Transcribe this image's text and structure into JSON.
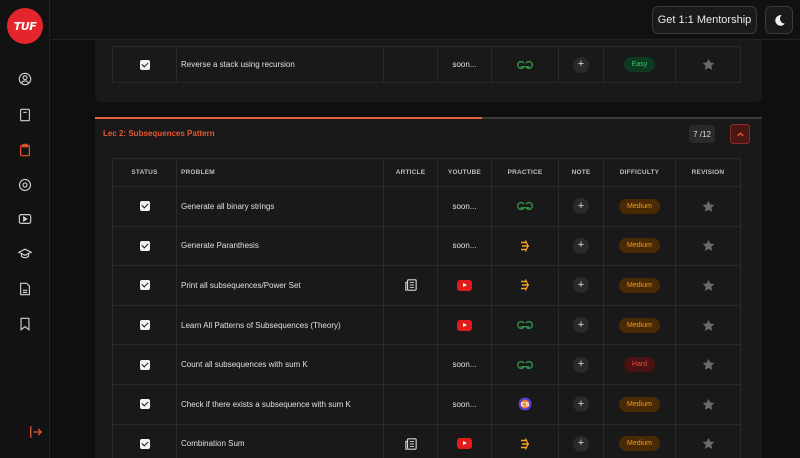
{
  "brand": {
    "logo_text": "TUF",
    "accent": "#e4262c"
  },
  "header": {
    "mentorship_label": "Get 1:1 Mentorship"
  },
  "sidebar": {
    "items": [
      {
        "icon": "user-circle-icon"
      },
      {
        "icon": "book-icon"
      },
      {
        "icon": "clipboard-icon",
        "active": true
      },
      {
        "icon": "settings-icon"
      },
      {
        "icon": "video-icon"
      },
      {
        "icon": "graduation-cap-icon"
      },
      {
        "icon": "document-icon"
      },
      {
        "icon": "bookmark-icon"
      }
    ],
    "logout_icon": "logout-icon"
  },
  "prev_section": {
    "rows": [
      {
        "problem": "Reverse a stack using recursion",
        "youtube": "soon...",
        "practice": "gfg",
        "difficulty": "Easy"
      }
    ]
  },
  "section": {
    "title": "Lec 2: Subsequences Pattern",
    "count": "7 /12",
    "progress_fraction": 0.58,
    "columns": [
      "STATUS",
      "PROBLEM",
      "ARTICLE",
      "YOUTUBE",
      "PRACTICE",
      "NOTE",
      "DIFFICULTY",
      "REVISION"
    ],
    "rows": [
      {
        "problem": "Generate all binary strings",
        "article": false,
        "youtube": "soon...",
        "practice": "gfg",
        "difficulty": "Medium"
      },
      {
        "problem": "Generate Paranthesis",
        "article": false,
        "youtube": "soon...",
        "practice": "codingninjas",
        "difficulty": "Medium"
      },
      {
        "problem": "Print all subsequences/Power Set",
        "article": true,
        "youtube": "video",
        "practice": "codingninjas",
        "difficulty": "Medium"
      },
      {
        "problem": "Learn All Patterns of Subsequences (Theory)",
        "article": false,
        "youtube": "video",
        "practice": "gfg",
        "difficulty": "Medium"
      },
      {
        "problem": "Count all subsequences with sum K",
        "article": false,
        "youtube": "soon...",
        "practice": "gfg",
        "difficulty": "Hard"
      },
      {
        "problem": "Check if there exists a subsequence with sum K",
        "article": false,
        "youtube": "soon...",
        "practice": "codestudio",
        "difficulty": "Medium"
      },
      {
        "problem": "Combination Sum",
        "article": true,
        "youtube": "video",
        "practice": "codingninjas",
        "difficulty": "Medium"
      }
    ]
  },
  "colors": {
    "easy_bg": "#0f3a22",
    "easy_fg": "#2ecc71",
    "medium_bg": "#4a2a05",
    "medium_fg": "#f39c12",
    "hard_bg": "#4a1212",
    "hard_fg": "#e74c3c",
    "gfg": "#2f8d46"
  }
}
